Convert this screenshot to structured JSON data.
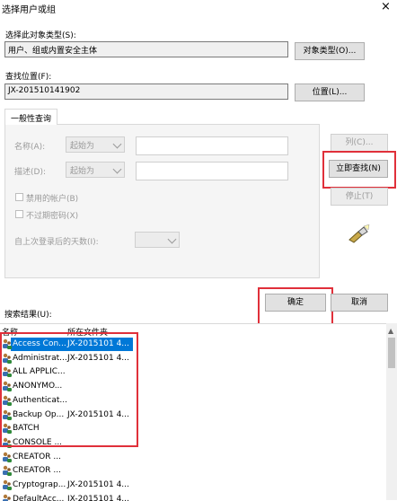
{
  "window": {
    "title": "选择用户或组",
    "close_glyph": "×"
  },
  "object_type": {
    "label": "选择此对象类型(S):",
    "value": "用户、组或内置安全主体",
    "button": "对象类型(O)..."
  },
  "location": {
    "label": "查找位置(F):",
    "value": "JX-201510141902",
    "button": "位置(L)..."
  },
  "tab": {
    "label": "一般性查询"
  },
  "query": {
    "name_label": "名称(A):",
    "name_mode": "起始为",
    "desc_label": "描述(D):",
    "desc_mode": "起始为",
    "disabled_accounts": "禁用的帐户(B)",
    "no_expire_pwd": "不过期密码(X)",
    "days_label": "自上次登录后的天数(I):"
  },
  "buttons": {
    "columns": "列(C)...",
    "find_now": "立即查找(N)",
    "stop": "停止(T)",
    "ok": "确定",
    "cancel": "取消"
  },
  "results": {
    "label": "搜索结果(U):",
    "columns": [
      "名称",
      "所在文件夹"
    ],
    "rows": [
      {
        "name": "Access Con...",
        "folder": "JX-2015101 4...",
        "selected": true
      },
      {
        "name": "Administrat...",
        "folder": "JX-2015101 4..."
      },
      {
        "name": "ALL APPLIC...",
        "folder": ""
      },
      {
        "name": "ANONYMO...",
        "folder": ""
      },
      {
        "name": "Authenticat...",
        "folder": ""
      },
      {
        "name": "Backup Op...",
        "folder": "JX-2015101 4..."
      },
      {
        "name": "BATCH",
        "folder": ""
      },
      {
        "name": "CONSOLE ...",
        "folder": ""
      },
      {
        "name": "CREATOR ...",
        "folder": ""
      },
      {
        "name": "CREATOR ...",
        "folder": ""
      },
      {
        "name": "Cryptograp...",
        "folder": "JX-2015101 4..."
      },
      {
        "name": "DefaultAcc...",
        "folder": "JX-2015101 4..."
      }
    ]
  },
  "colors": {
    "accent": "#0078d7",
    "highlight_box": "#e0303a"
  }
}
